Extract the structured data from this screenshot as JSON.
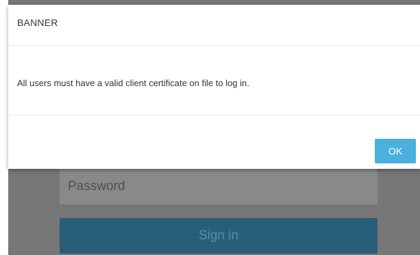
{
  "login_form": {
    "password_placeholder": "Password",
    "signin_label": "Sign in"
  },
  "dialog": {
    "title": "BANNER",
    "message": "All users must have a valid client certificate on file to log in.",
    "ok_label": "OK"
  },
  "colors": {
    "overlay": "#777777",
    "signin_button": "#295e78",
    "ok_button": "#4ab0de"
  }
}
